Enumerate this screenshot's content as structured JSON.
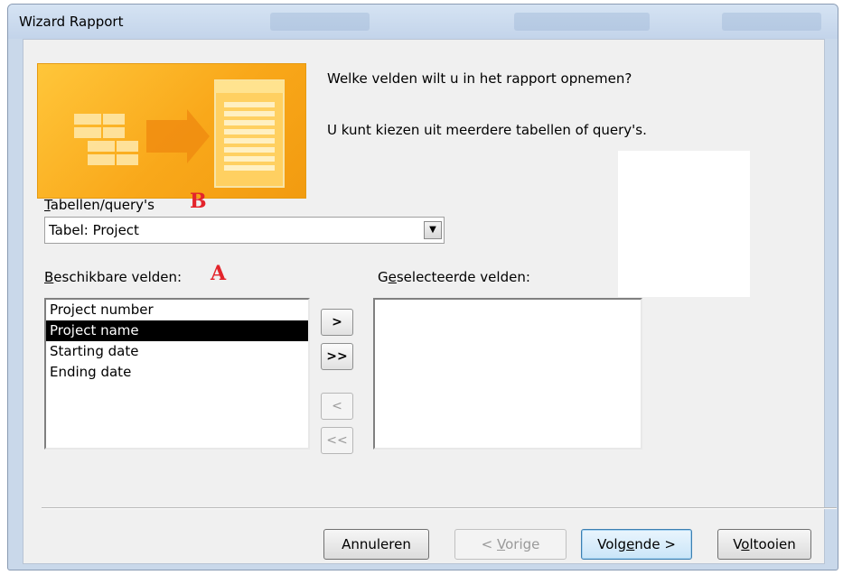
{
  "window": {
    "title": "Wizard Rapport"
  },
  "intro": {
    "question": "Welke velden wilt u in het rapport opnemen?",
    "hint": "U kunt kiezen uit meerdere tabellen of query's."
  },
  "tables": {
    "label_accel": "T",
    "label_rest": "abellen/query's",
    "marker": "B",
    "selected": "Tabel: Project"
  },
  "available": {
    "label_accel": "B",
    "label_rest": "eschikbare velden:",
    "marker": "A",
    "items": [
      "Project number",
      "Project name",
      "Starting date",
      "Ending date"
    ],
    "selected_index": 1
  },
  "selected": {
    "label_pre": "G",
    "label_accel": "e",
    "label_rest": "selecteerde velden:"
  },
  "move_buttons": {
    "add_one": ">",
    "add_all": ">>",
    "remove_one": "<",
    "remove_all": "<<"
  },
  "footer": {
    "cancel": "Annuleren",
    "prev_pre": "< ",
    "prev_accel": "V",
    "prev_rest": "orige",
    "next_pre": "Volg",
    "next_accel": "e",
    "next_rest": "nde >",
    "finish_pre": "V",
    "finish_accel": "o",
    "finish_rest": "ltooien"
  }
}
